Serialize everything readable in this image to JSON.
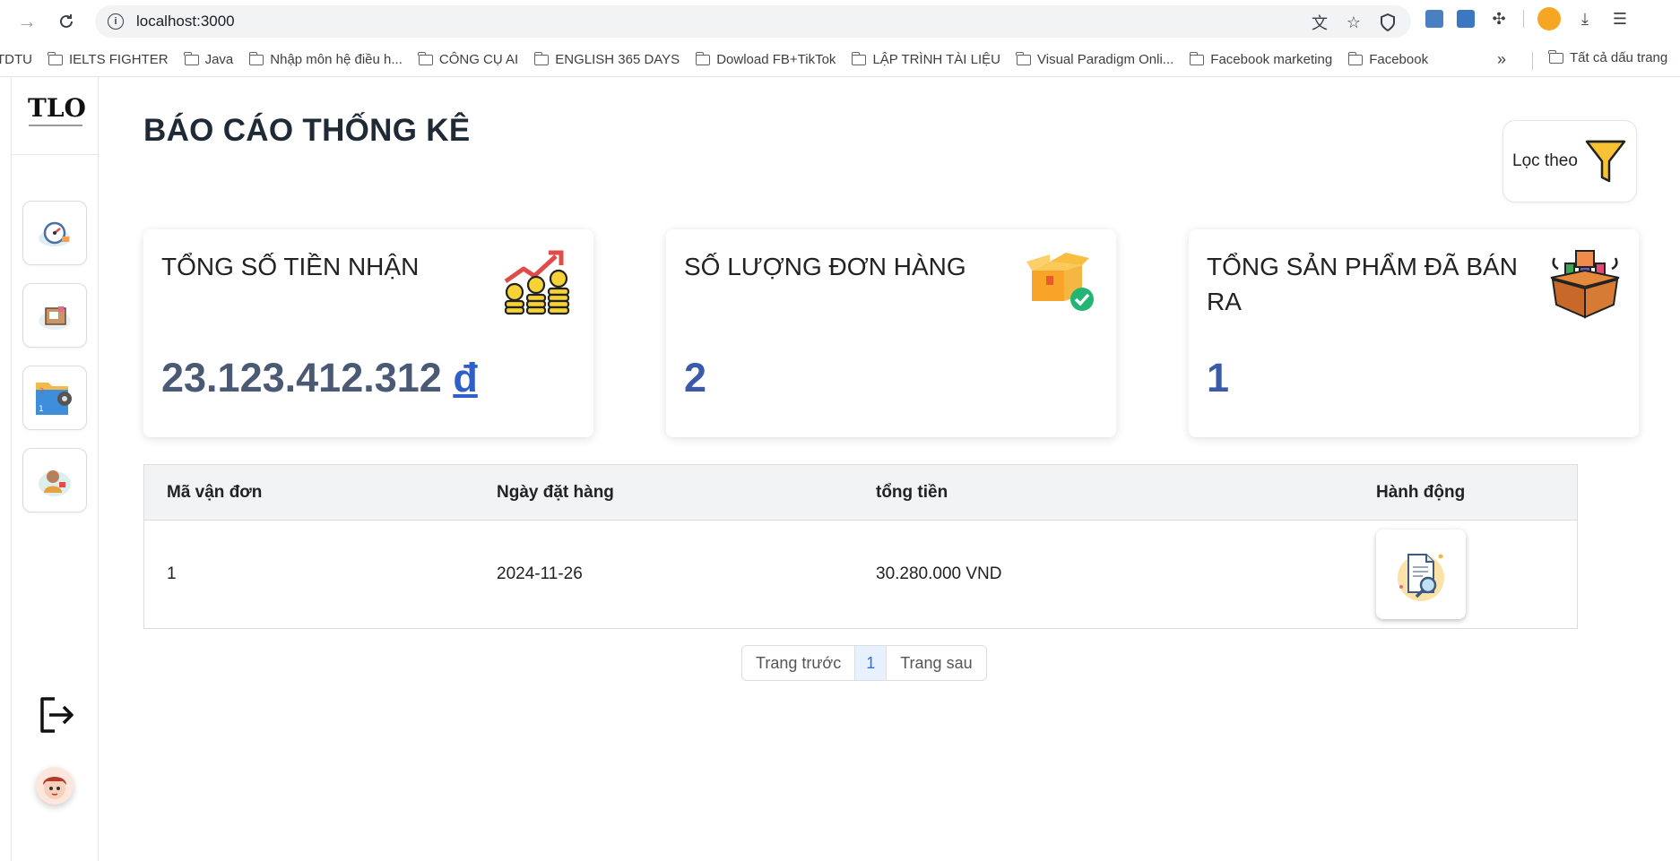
{
  "browser": {
    "url": "localhost:3000",
    "bookmarks": [
      "TDTU",
      "IELTS FIGHTER",
      "Java",
      "Nhập môn hệ điều h...",
      "CÔNG CỤ AI",
      "ENGLISH 365 DAYS",
      "Dowload FB+TikTok",
      "LẬP TRÌNH TÀI LIỆU",
      "Visual Paradigm Onli...",
      "Facebook marketing",
      "Facebook"
    ],
    "all_bookmarks": "Tất cả dấu trang"
  },
  "sidebar": {
    "logo": "TLO",
    "items": [
      "dashboard-icon",
      "orders-icon",
      "products-folder-icon",
      "support-agent-icon"
    ]
  },
  "page": {
    "title": "BÁO CÁO THỐNG KÊ",
    "filter_label": "Lọc theo"
  },
  "cards": [
    {
      "title": "TỔNG SỐ TIỀN NHẬN",
      "value": "23.123.412.312",
      "currency": "đ"
    },
    {
      "title": "SỐ LƯỢNG ĐƠN HÀNG",
      "value": "2"
    },
    {
      "title": "TỔNG SẢN PHẨM ĐÃ BÁN RA",
      "value": "1"
    }
  ],
  "table": {
    "headers": [
      "Mã vận đơn",
      "Ngày đặt hàng",
      "tổng tiền",
      "Hành động"
    ],
    "rows": [
      {
        "id": "1",
        "date": "2024-11-26",
        "total": "30.280.000 VND"
      }
    ]
  },
  "pagination": {
    "prev": "Trang trước",
    "current": "1",
    "next": "Trang sau"
  }
}
